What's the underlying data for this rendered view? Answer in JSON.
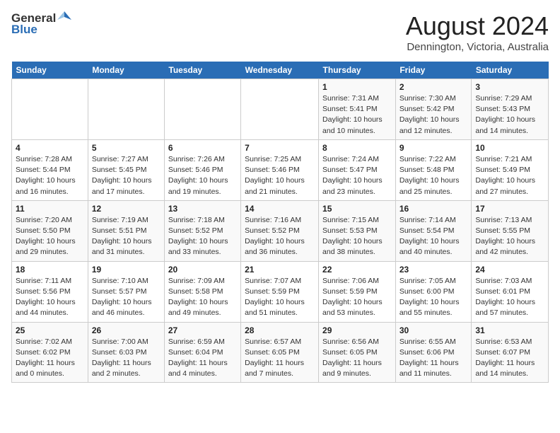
{
  "header": {
    "logo_general": "General",
    "logo_blue": "Blue",
    "title": "August 2024",
    "subtitle": "Dennington, Victoria, Australia"
  },
  "days_of_week": [
    "Sunday",
    "Monday",
    "Tuesday",
    "Wednesday",
    "Thursday",
    "Friday",
    "Saturday"
  ],
  "weeks": [
    [
      {
        "day": "",
        "detail": ""
      },
      {
        "day": "",
        "detail": ""
      },
      {
        "day": "",
        "detail": ""
      },
      {
        "day": "",
        "detail": ""
      },
      {
        "day": "1",
        "detail": "Sunrise: 7:31 AM\nSunset: 5:41 PM\nDaylight: 10 hours\nand 10 minutes."
      },
      {
        "day": "2",
        "detail": "Sunrise: 7:30 AM\nSunset: 5:42 PM\nDaylight: 10 hours\nand 12 minutes."
      },
      {
        "day": "3",
        "detail": "Sunrise: 7:29 AM\nSunset: 5:43 PM\nDaylight: 10 hours\nand 14 minutes."
      }
    ],
    [
      {
        "day": "4",
        "detail": "Sunrise: 7:28 AM\nSunset: 5:44 PM\nDaylight: 10 hours\nand 16 minutes."
      },
      {
        "day": "5",
        "detail": "Sunrise: 7:27 AM\nSunset: 5:45 PM\nDaylight: 10 hours\nand 17 minutes."
      },
      {
        "day": "6",
        "detail": "Sunrise: 7:26 AM\nSunset: 5:46 PM\nDaylight: 10 hours\nand 19 minutes."
      },
      {
        "day": "7",
        "detail": "Sunrise: 7:25 AM\nSunset: 5:46 PM\nDaylight: 10 hours\nand 21 minutes."
      },
      {
        "day": "8",
        "detail": "Sunrise: 7:24 AM\nSunset: 5:47 PM\nDaylight: 10 hours\nand 23 minutes."
      },
      {
        "day": "9",
        "detail": "Sunrise: 7:22 AM\nSunset: 5:48 PM\nDaylight: 10 hours\nand 25 minutes."
      },
      {
        "day": "10",
        "detail": "Sunrise: 7:21 AM\nSunset: 5:49 PM\nDaylight: 10 hours\nand 27 minutes."
      }
    ],
    [
      {
        "day": "11",
        "detail": "Sunrise: 7:20 AM\nSunset: 5:50 PM\nDaylight: 10 hours\nand 29 minutes."
      },
      {
        "day": "12",
        "detail": "Sunrise: 7:19 AM\nSunset: 5:51 PM\nDaylight: 10 hours\nand 31 minutes."
      },
      {
        "day": "13",
        "detail": "Sunrise: 7:18 AM\nSunset: 5:52 PM\nDaylight: 10 hours\nand 33 minutes."
      },
      {
        "day": "14",
        "detail": "Sunrise: 7:16 AM\nSunset: 5:52 PM\nDaylight: 10 hours\nand 36 minutes."
      },
      {
        "day": "15",
        "detail": "Sunrise: 7:15 AM\nSunset: 5:53 PM\nDaylight: 10 hours\nand 38 minutes."
      },
      {
        "day": "16",
        "detail": "Sunrise: 7:14 AM\nSunset: 5:54 PM\nDaylight: 10 hours\nand 40 minutes."
      },
      {
        "day": "17",
        "detail": "Sunrise: 7:13 AM\nSunset: 5:55 PM\nDaylight: 10 hours\nand 42 minutes."
      }
    ],
    [
      {
        "day": "18",
        "detail": "Sunrise: 7:11 AM\nSunset: 5:56 PM\nDaylight: 10 hours\nand 44 minutes."
      },
      {
        "day": "19",
        "detail": "Sunrise: 7:10 AM\nSunset: 5:57 PM\nDaylight: 10 hours\nand 46 minutes."
      },
      {
        "day": "20",
        "detail": "Sunrise: 7:09 AM\nSunset: 5:58 PM\nDaylight: 10 hours\nand 49 minutes."
      },
      {
        "day": "21",
        "detail": "Sunrise: 7:07 AM\nSunset: 5:59 PM\nDaylight: 10 hours\nand 51 minutes."
      },
      {
        "day": "22",
        "detail": "Sunrise: 7:06 AM\nSunset: 5:59 PM\nDaylight: 10 hours\nand 53 minutes."
      },
      {
        "day": "23",
        "detail": "Sunrise: 7:05 AM\nSunset: 6:00 PM\nDaylight: 10 hours\nand 55 minutes."
      },
      {
        "day": "24",
        "detail": "Sunrise: 7:03 AM\nSunset: 6:01 PM\nDaylight: 10 hours\nand 57 minutes."
      }
    ],
    [
      {
        "day": "25",
        "detail": "Sunrise: 7:02 AM\nSunset: 6:02 PM\nDaylight: 11 hours\nand 0 minutes."
      },
      {
        "day": "26",
        "detail": "Sunrise: 7:00 AM\nSunset: 6:03 PM\nDaylight: 11 hours\nand 2 minutes."
      },
      {
        "day": "27",
        "detail": "Sunrise: 6:59 AM\nSunset: 6:04 PM\nDaylight: 11 hours\nand 4 minutes."
      },
      {
        "day": "28",
        "detail": "Sunrise: 6:57 AM\nSunset: 6:05 PM\nDaylight: 11 hours\nand 7 minutes."
      },
      {
        "day": "29",
        "detail": "Sunrise: 6:56 AM\nSunset: 6:05 PM\nDaylight: 11 hours\nand 9 minutes."
      },
      {
        "day": "30",
        "detail": "Sunrise: 6:55 AM\nSunset: 6:06 PM\nDaylight: 11 hours\nand 11 minutes."
      },
      {
        "day": "31",
        "detail": "Sunrise: 6:53 AM\nSunset: 6:07 PM\nDaylight: 11 hours\nand 14 minutes."
      }
    ]
  ]
}
